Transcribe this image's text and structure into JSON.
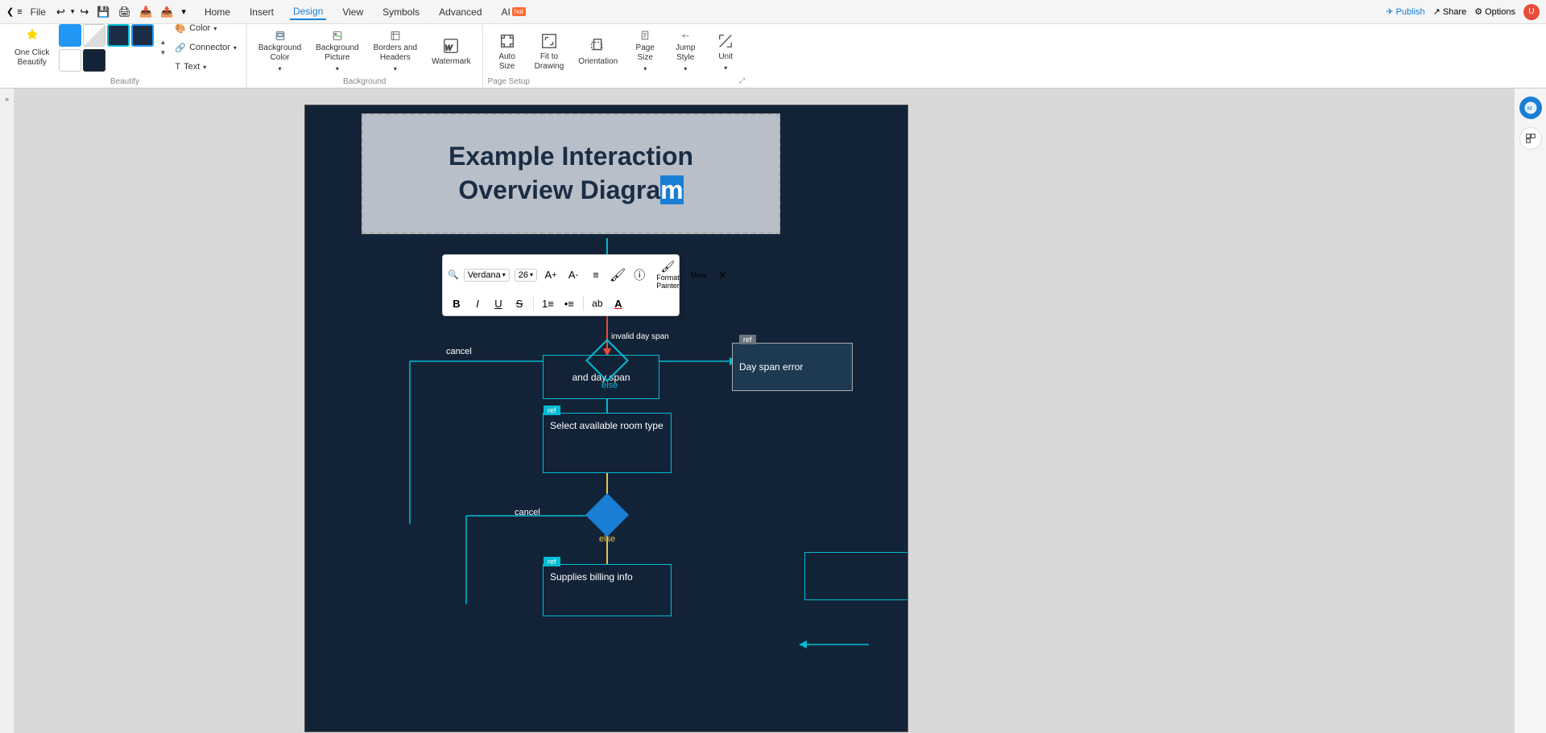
{
  "topbar": {
    "file_label": "File",
    "undo_tooltip": "Undo",
    "redo_tooltip": "Redo",
    "save_tooltip": "Save",
    "print_tooltip": "Print",
    "import_tooltip": "Import",
    "export_tooltip": "Export",
    "nav_items": [
      "Home",
      "Insert",
      "Design",
      "View",
      "Symbols",
      "Advanced",
      "AI"
    ],
    "active_nav": "Design",
    "publish_label": "Publish",
    "share_label": "Share",
    "options_label": "Options"
  },
  "ribbon": {
    "beautify_section_label": "Beautify",
    "background_section_label": "Background",
    "page_setup_section_label": "Page Setup",
    "one_click_beautify_label": "One Click\nBeautify",
    "color_label": "Color",
    "connector_label": "Connector",
    "text_label": "Text",
    "bg_color_label": "Background\nColor",
    "bg_picture_label": "Background\nPicture",
    "borders_headers_label": "Borders and\nHeaders",
    "watermark_label": "Watermark",
    "auto_size_label": "Auto\nSize",
    "fit_to_drawing_label": "Fit to\nDrawing",
    "orientation_label": "Orientation",
    "page_size_label": "Page\nSize",
    "jump_style_label": "Jump\nStyle",
    "unit_label": "Unit"
  },
  "floating_toolbar": {
    "font": "Verdana",
    "font_size": "26",
    "bold_label": "B",
    "italic_label": "I",
    "underline_label": "U",
    "strikethrough_label": "S",
    "list_label": "≡",
    "numbered_list_label": "≣",
    "ab_label": "ab",
    "font_color_label": "A",
    "format_painter_label": "Format\nPainter",
    "more_label": "More",
    "increase_font_label": "A+",
    "decrease_font_label": "A-",
    "align_label": "≡"
  },
  "diagram": {
    "title": "Example Interaction Overview Diagram",
    "title_highlight_char": "m",
    "nodes": [
      {
        "id": "day-span-error",
        "type": "ref-box",
        "label": "Day span error",
        "ref": "ref"
      },
      {
        "id": "select-room",
        "type": "flow-box",
        "label": "Select available room type",
        "ref": "ref"
      },
      {
        "id": "supplies-billing",
        "type": "flow-box",
        "label": "Supplies billing info",
        "ref": "ref"
      }
    ],
    "labels": {
      "cancel1": "cancel",
      "cancel2": "cancel",
      "else1": "else",
      "else2": "else",
      "invalid_day_span": "invalid day span",
      "and_day_span": "and day span"
    }
  },
  "colors": {
    "canvas_bg": "#132337",
    "accent_cyan": "#00bcd4",
    "accent_blue": "#1a7fd4",
    "title_bg": "#b8bfc8",
    "error_indicator": "#e74c3c"
  }
}
